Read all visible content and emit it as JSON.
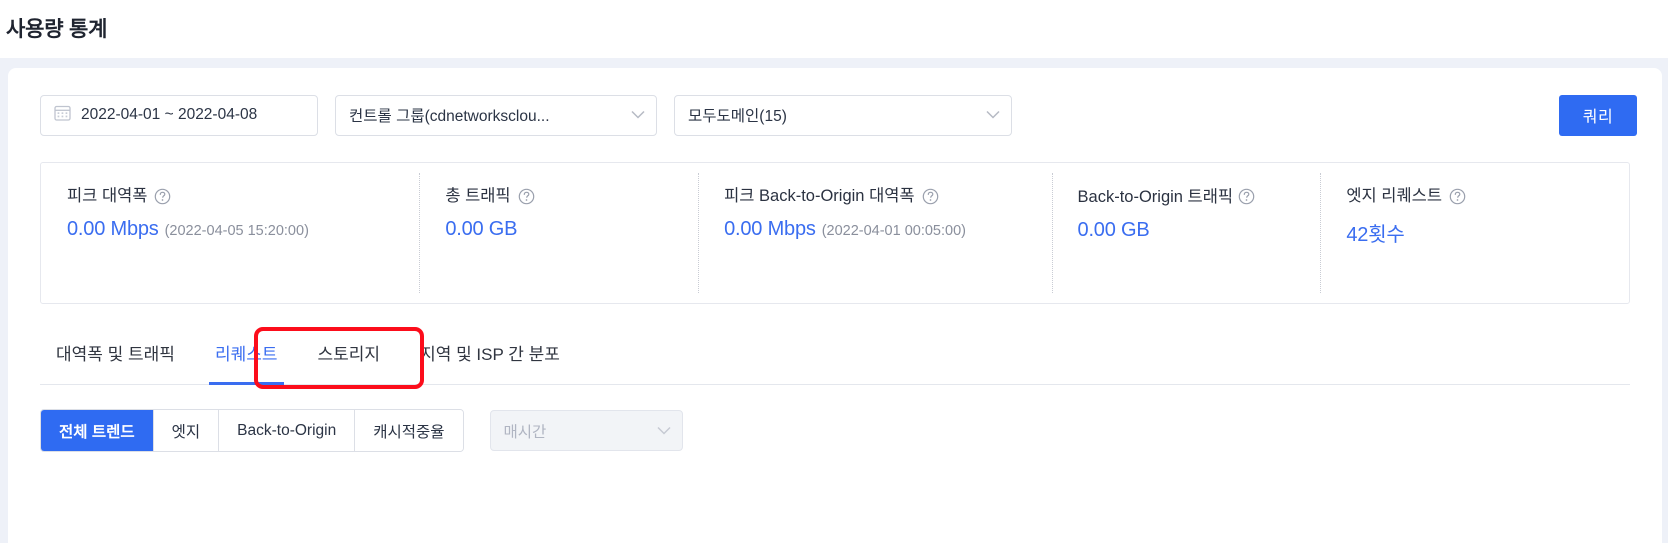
{
  "page": {
    "title": "사용량 통계"
  },
  "filters": {
    "date_range": {
      "value": "2022-04-01 ~ 2022-04-08",
      "icon": "calendar-icon"
    },
    "control_group": {
      "value": "컨트롤 그룹(cdnetworksclou...",
      "icon": "chevron-down-icon"
    },
    "domain": {
      "value": "모두도메인(15)",
      "icon": "chevron-down-icon"
    },
    "query_button": "쿼리"
  },
  "stats": [
    {
      "label": "피크 대역폭",
      "help": "help-icon",
      "value": "0.00 Mbps",
      "sub": "(2022-04-05 15:20:00)"
    },
    {
      "label": "총 트래픽",
      "help": "help-icon",
      "value": "0.00 GB",
      "sub": ""
    },
    {
      "label": "피크 Back-to-Origin 대역폭",
      "help": "help-icon",
      "value": "0.00 Mbps",
      "sub": "(2022-04-01 00:05:00)"
    },
    {
      "label": "Back-to-Origin 트래픽",
      "help": "help-icon",
      "value": "0.00 GB",
      "sub": ""
    },
    {
      "label": "엣지 리퀘스트",
      "help": "help-icon",
      "value": "42횟수",
      "sub": ""
    }
  ],
  "tabs": [
    {
      "label": "대역폭 및 트래픽",
      "active": false
    },
    {
      "label": "리퀘스트",
      "active": true
    },
    {
      "label": "스토리지",
      "active": false
    },
    {
      "label": "지역 및 ISP 간 분포",
      "active": false
    }
  ],
  "subtabs": [
    {
      "label": "전체 트렌드",
      "active": true
    },
    {
      "label": "엣지",
      "active": false
    },
    {
      "label": "Back-to-Origin",
      "active": false
    },
    {
      "label": "캐시적중율",
      "active": false
    }
  ],
  "granularity": {
    "value": "매시간",
    "icon": "chevron-down-icon",
    "disabled": true
  },
  "colors": {
    "accent": "#2f6bf2",
    "link": "#3a6df0",
    "annotation": "#fc0d1b",
    "page_bg": "#eef1f8",
    "border": "#dcdfe6"
  }
}
